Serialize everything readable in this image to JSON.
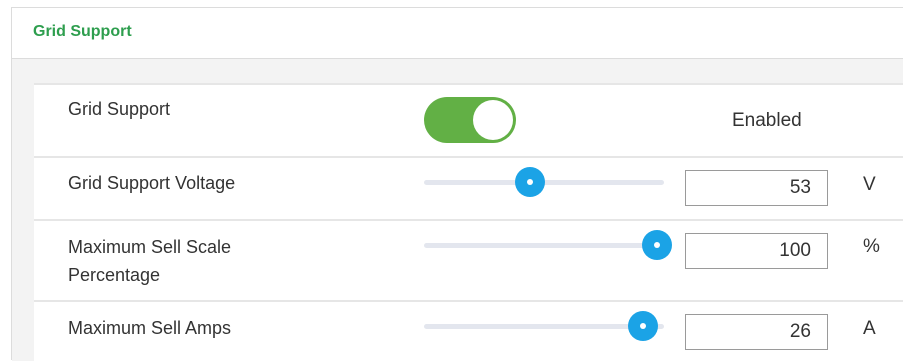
{
  "panel": {
    "title": "Grid Support"
  },
  "colors": {
    "title_green": "#2e9e4e",
    "toggle_on": "#62b045",
    "slider_thumb": "#1ba3e6",
    "slider_track": "#e3e6ee"
  },
  "grid_support": {
    "label": "Grid Support",
    "enabled": true,
    "status": "Enabled"
  },
  "voltage": {
    "label": "Grid Support Voltage",
    "value": "53",
    "unit": "V",
    "slider_fraction": 0.44
  },
  "sell_scale": {
    "label": "Maximum Sell Scale Percentage",
    "value": "100",
    "unit": "%",
    "slider_fraction": 1.0
  },
  "sell_amps": {
    "label": "Maximum Sell Amps",
    "value": "26",
    "unit": "A",
    "slider_fraction": 0.94
  }
}
